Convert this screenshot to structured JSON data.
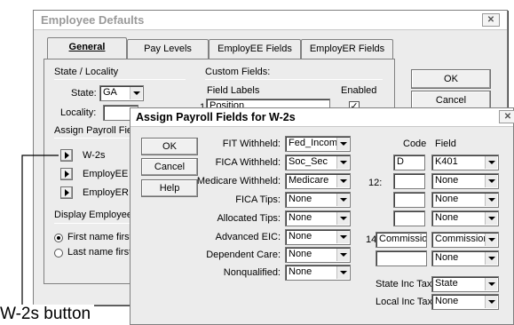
{
  "main_window": {
    "title": "Employee Defaults",
    "tabs": [
      "General",
      "Pay Levels",
      "EmployEE Fields",
      "EmployER Fields"
    ],
    "ok_label": "OK",
    "cancel_label": "Cancel",
    "state_section_label": "State / Locality",
    "state_label": "State:",
    "state_value": "GA",
    "locality_label": "Locality:",
    "custom_fields_label": "Custom Fields:",
    "field_labels_header": "Field Labels",
    "enabled_header": "Enabled",
    "row1_num": "1",
    "row1_value": "Position",
    "row1_enabled": "✓",
    "assign_payroll_label": "Assign Payroll Fields",
    "w2s_label": "W-2s",
    "employee_label": "EmployEE Pa",
    "employer_label": "EmployER Pa",
    "display_label": "Display Employee Na",
    "first_name_first": "First name first (J",
    "last_name_first": "Last name first (D"
  },
  "dialog": {
    "title": "Assign Payroll Fields for W-2s",
    "ok_label": "OK",
    "cancel_label": "Cancel",
    "help_label": "Help",
    "fields": [
      {
        "label": "FIT Withheld:",
        "value": "Fed_Income"
      },
      {
        "label": "FICA Withheld:",
        "value": "Soc_Sec"
      },
      {
        "label": "Medicare Withheld:",
        "value": "Medicare"
      },
      {
        "label": "FICA Tips:",
        "value": "None"
      },
      {
        "label": "Allocated Tips:",
        "value": "None"
      },
      {
        "label": "Advanced EIC:",
        "value": "None"
      },
      {
        "label": "Dependent Care:",
        "value": "None"
      },
      {
        "label": "Nonqualified:",
        "value": "None"
      }
    ],
    "code_header": "Code",
    "field_header": "Field",
    "box12_label": "12:",
    "box14_label": "14:",
    "box12_rows": [
      {
        "code": "D",
        "field": "K401"
      },
      {
        "code": "",
        "field": "None"
      },
      {
        "code": "",
        "field": "None"
      },
      {
        "code": "",
        "field": "None"
      }
    ],
    "box14_rows": [
      {
        "code": "Commissions",
        "field": "Commission"
      },
      {
        "code": "",
        "field": "None"
      }
    ],
    "state_inc_tax_label": "State Inc Tax:",
    "state_inc_tax_value": "State",
    "local_inc_tax_label": "Local Inc Tax:",
    "local_inc_tax_value": "None"
  },
  "callout": {
    "text": "W-2s button"
  }
}
